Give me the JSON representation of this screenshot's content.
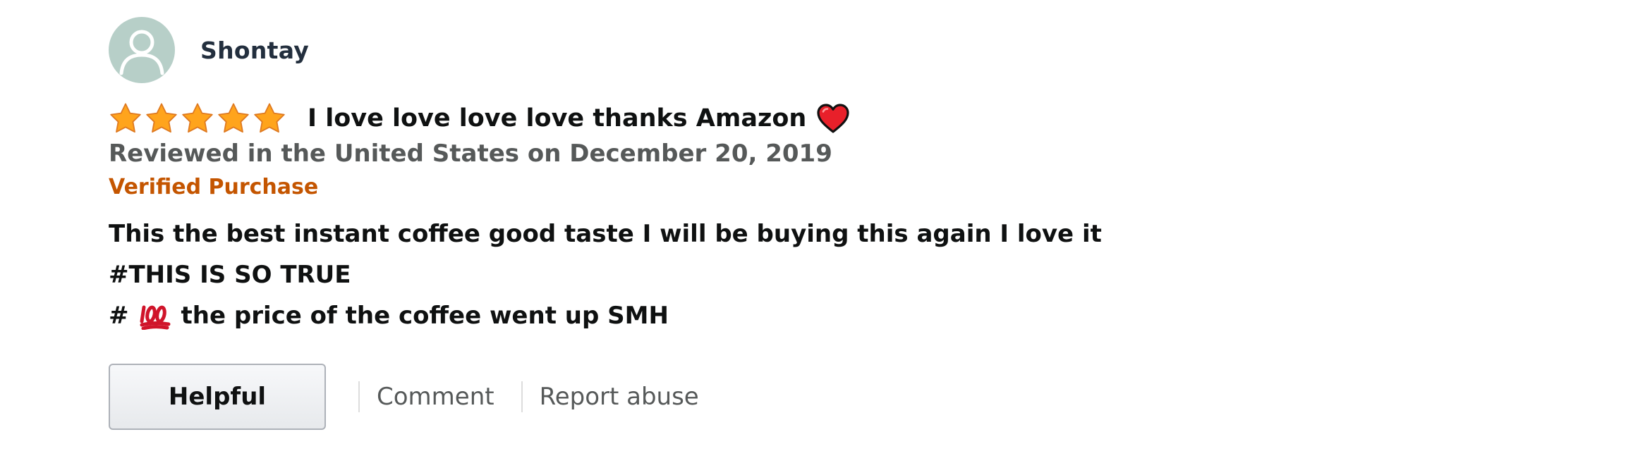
{
  "profile": {
    "name": "Shontay",
    "avatar_icon": "user-silhouette-icon"
  },
  "review": {
    "rating": 5,
    "rating_max": 5,
    "title": "I love love love love thanks Amazon",
    "title_emoji": "heart-icon",
    "date_text": "Reviewed in the United States on December 20, 2019",
    "verified_label": "Verified Purchase",
    "body": {
      "line1": "This the best instant coffee good taste I will be buying this again I love it",
      "line2": "#THIS IS SO TRUE",
      "line3_prefix": "#",
      "line3_emoji": "hundred-points-icon",
      "line3_rest": "the price of the coffee went up SMH"
    }
  },
  "actions": {
    "helpful_label": "Helpful",
    "comment_label": "Comment",
    "report_label": "Report abuse"
  },
  "colors": {
    "star": "#ffa41c",
    "verified": "#c45500",
    "avatar_bg": "#b7cfc8",
    "muted_text": "#565959",
    "heart": "#e8202a",
    "hundred": "#d0142a"
  }
}
